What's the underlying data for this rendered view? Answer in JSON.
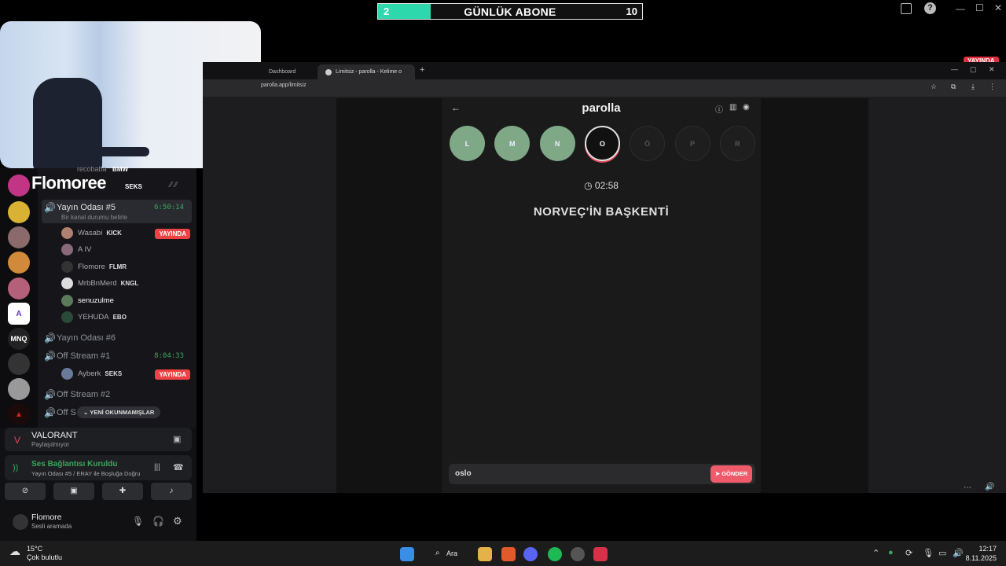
{
  "overlay": {
    "sub_goal": {
      "current": "2",
      "label": "GÜNLÜK ABONE",
      "target": "10",
      "progress": 0.2
    }
  },
  "window": {
    "live_badge": "YAYINDA"
  },
  "discord": {
    "streamer_name": "Flomoree",
    "top_partial": {
      "name": "recobaba",
      "tag": "BMW",
      "tag2": "SEKS"
    },
    "channels": [
      {
        "name": "Yayın Odası #5",
        "status": "Bir kanal durumu belirle",
        "timer": "6:50:14"
      },
      {
        "name": "Yayın Odası #6"
      },
      {
        "name": "Off Stream #1",
        "timer": "8:04:33"
      },
      {
        "name": "Off Stream #2"
      },
      {
        "name": "Off S"
      }
    ],
    "room5_users": [
      {
        "name": "Wasabi",
        "tag": "KICK",
        "live": "YAYINDA"
      },
      {
        "name": "A IV"
      },
      {
        "name": "Flomore",
        "tag": "FLMR"
      },
      {
        "name": "MrbBnMerd",
        "tag": "KNGL"
      },
      {
        "name": "senuzulme"
      },
      {
        "name": "YEHUDA",
        "tag": "EBO"
      }
    ],
    "off1_users": [
      {
        "name": "Ayberk",
        "tag": "SEKS",
        "live": "YAYINDA"
      }
    ],
    "unread_pill": "YENİ OKUNMAMIŞLAR",
    "activity": {
      "game": "VALORANT",
      "sub": "Paylaşılmıyor"
    },
    "voice": {
      "status": "Ses Bağlantısı Kuruldu",
      "detail": "Yayın Odası #5 / ERAY ile Boşluğa Doğru"
    },
    "user": {
      "name": "Flomore",
      "status": "Sesli aramada"
    },
    "server_labels": {
      "mnq": "MNQ"
    }
  },
  "browser": {
    "tabs": [
      {
        "title": "Dashboard"
      },
      {
        "title": "Limitsiz - parolla - Kelime o"
      }
    ],
    "url": "parolla.app/limitsiz",
    "app": {
      "title": "parolla",
      "letters": [
        {
          "letter": "L",
          "state": "done"
        },
        {
          "letter": "M",
          "state": "done"
        },
        {
          "letter": "N",
          "state": "done"
        },
        {
          "letter": "O",
          "state": "current"
        },
        {
          "letter": "Ö",
          "state": "todo"
        },
        {
          "letter": "P",
          "state": "todo"
        },
        {
          "letter": "R",
          "state": "todo"
        }
      ],
      "timer": "02:58",
      "question": "NORVEÇ'İN BAŞKENTİ",
      "answer_value": "oslo",
      "send_label": "GÖNDER"
    }
  },
  "taskbar": {
    "weather_temp": "15°C",
    "weather_desc": "Çok bulutlu",
    "search_label": "Ara",
    "time": "12:17",
    "date": "8.11.2025"
  },
  "colors": {
    "accent_green": "#3ba55d",
    "live_red": "#ed4245",
    "done_green": "#7fa886",
    "send_red": "#f05b6b",
    "sub_fill": "#2ed8ad"
  }
}
